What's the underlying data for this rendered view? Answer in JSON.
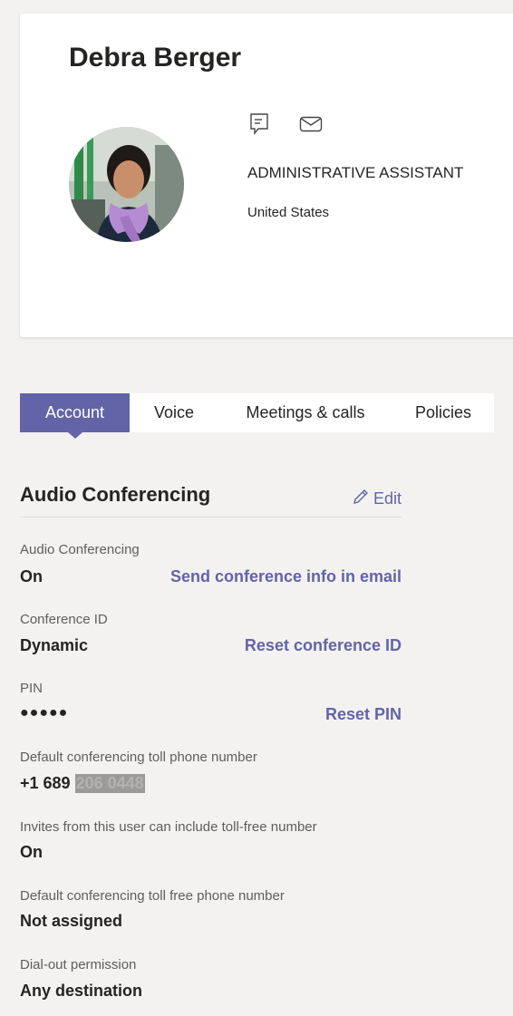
{
  "profile": {
    "name": "Debra Berger",
    "job_title": "ADMINISTRATIVE ASSISTANT",
    "location": "United States",
    "actions": {
      "chat_icon": "chat-icon",
      "mail_icon": "mail-icon"
    }
  },
  "tabs": [
    {
      "label": "Account",
      "active": true
    },
    {
      "label": "Voice",
      "active": false
    },
    {
      "label": "Meetings & calls",
      "active": false
    },
    {
      "label": "Policies",
      "active": false
    }
  ],
  "section": {
    "title": "Audio Conferencing",
    "edit_label": "Edit",
    "edit_icon": "pencil-icon"
  },
  "fields": {
    "audio_conferencing": {
      "label": "Audio Conferencing",
      "value": "On",
      "action": "Send conference info in email"
    },
    "conference_id": {
      "label": "Conference ID",
      "value": "Dynamic",
      "action": "Reset conference ID"
    },
    "pin": {
      "label": "PIN",
      "value": "●●●●●",
      "action": "Reset PIN"
    },
    "toll_number": {
      "label": "Default conferencing toll phone number",
      "value_prefix": "+1 689",
      "value_redacted": "206 0448"
    },
    "toll_free_invites": {
      "label": "Invites from this user can include toll-free number",
      "value": "On"
    },
    "toll_free_number": {
      "label": "Default conferencing toll free phone number",
      "value": "Not assigned"
    },
    "dial_out": {
      "label": "Dial-out permission",
      "value": "Any destination"
    }
  },
  "colors": {
    "accent": "#6264a7",
    "background": "#f3f2f1",
    "card": "#ffffff",
    "text": "#252423",
    "secondary_text": "#605e5c"
  }
}
